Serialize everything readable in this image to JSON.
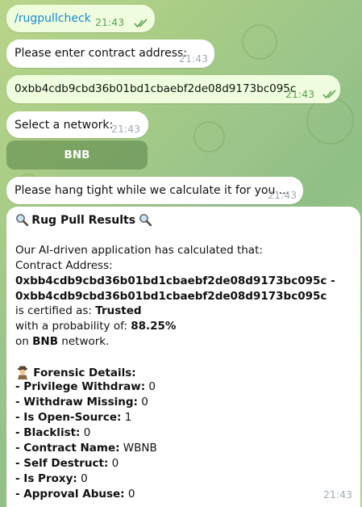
{
  "messages": [
    {
      "text": "/rugpullcheck",
      "time": "21:43"
    },
    {
      "text": "Please enter contract address:",
      "time": "21:43"
    },
    {
      "text": "0xbb4cdb9cbd36b01bd1cbaebf2de08d9173bc095c",
      "time": "21:43"
    },
    {
      "text": "Select a network:",
      "time": "21:43"
    },
    {
      "text": "Please hang tight while we calculate it for you ...",
      "time": "21:43"
    }
  ],
  "keyboard": {
    "button": "BNB"
  },
  "result": {
    "title": "Rug Pull Results",
    "intro": "Our AI-driven application has calculated that:",
    "contract_label": "Contract Address:",
    "address1": "0xbb4cdb9cbd36b01bd1cbaebf2de08d9173bc095c -",
    "address2": "0xbb4cdb9cbd36b01bd1cbaebf2de08d9173bc095c",
    "certified_prefix": "is certified as: ",
    "certified_value": "Trusted",
    "probability_prefix": "with a probability of: ",
    "probability_value": "88.25%",
    "network_prefix": "on ",
    "network_value": "BNB",
    "network_suffix": " network.",
    "forensic_title": "Forensic Details:",
    "details": [
      {
        "label": "- Privilege Withdraw:",
        "value": " 0"
      },
      {
        "label": "- Withdraw Missing:",
        "value": " 0"
      },
      {
        "label": "- Is Open-Source:",
        "value": " 1"
      },
      {
        "label": "- Blacklist:",
        "value": " 0"
      },
      {
        "label": "- Contract Name:",
        "value": " WBNB"
      },
      {
        "label": "- Self Destruct:",
        "value": " 0"
      },
      {
        "label": "- Is Proxy:",
        "value": " 0"
      },
      {
        "label": "- Approval Abuse:",
        "value": " 0"
      }
    ],
    "time": "21:43"
  }
}
